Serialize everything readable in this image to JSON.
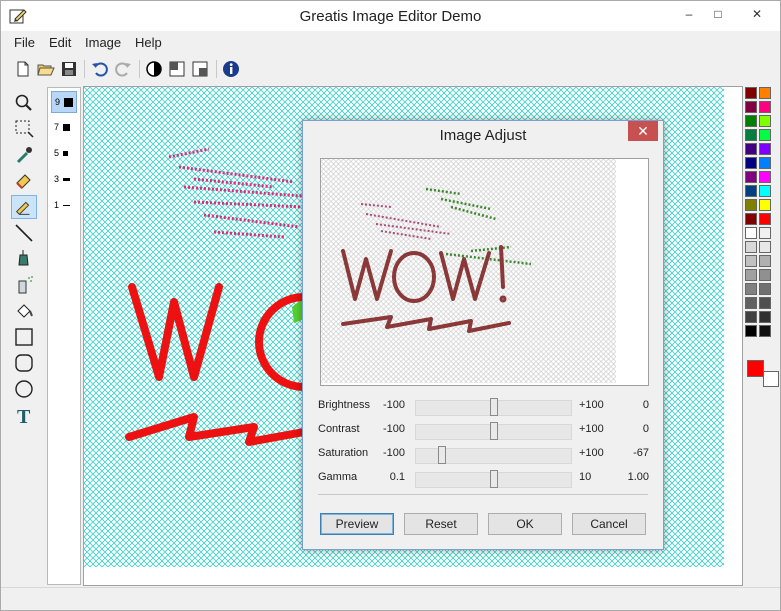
{
  "window": {
    "title": "Greatis Image Editor Demo"
  },
  "menu": {
    "items": [
      "File",
      "Edit",
      "Image",
      "Help"
    ]
  },
  "window_controls": {
    "minimize": "–",
    "maximize": "□",
    "close": "✕"
  },
  "brush_sizes": [
    "9",
    "7",
    "5",
    "3",
    "1"
  ],
  "canvas_text": "WO",
  "dialog": {
    "title": "Image Adjust",
    "close": "✕",
    "preview_text": "WOW!",
    "rows": [
      {
        "label": "Brightness",
        "min": "-100",
        "max": "+100",
        "value": "0"
      },
      {
        "label": "Contrast",
        "min": "-100",
        "max": "+100",
        "value": "0"
      },
      {
        "label": "Saturation",
        "min": "-100",
        "max": "+100",
        "value": "-67"
      },
      {
        "label": "Gamma",
        "min": "0.1",
        "max": "10",
        "value": "1.00"
      }
    ],
    "slider_positions": [
      0.5,
      0.5,
      0.165,
      0.5
    ],
    "buttons": {
      "preview": "Preview",
      "reset": "Reset",
      "ok": "OK",
      "cancel": "Cancel"
    }
  },
  "colors": {
    "palette": [
      "#800000",
      "#ff8000",
      "#800040",
      "#ff0080",
      "#008000",
      "#80ff00",
      "#008040",
      "#00ff40",
      "#400080",
      "#8000ff",
      "#000080",
      "#0080ff",
      "#800080",
      "#ff00ff",
      "#004080",
      "#00ffff",
      "#808000",
      "#ffff00",
      "#800000",
      "#ff0000",
      "#ffffff",
      "#f0f0f0",
      "#d8d8d8",
      "#e8e8e8",
      "#c0c0c0",
      "#b0b0b0",
      "#a0a0a0",
      "#909090",
      "#808080",
      "#707070",
      "#606060",
      "#505050",
      "#404040",
      "#303030",
      "#000000",
      "#101010"
    ],
    "primary": "#ff0000",
    "secondary": "#ffffff",
    "canvas_grid": "#39d0c8",
    "dialog_close": "#c75050"
  }
}
